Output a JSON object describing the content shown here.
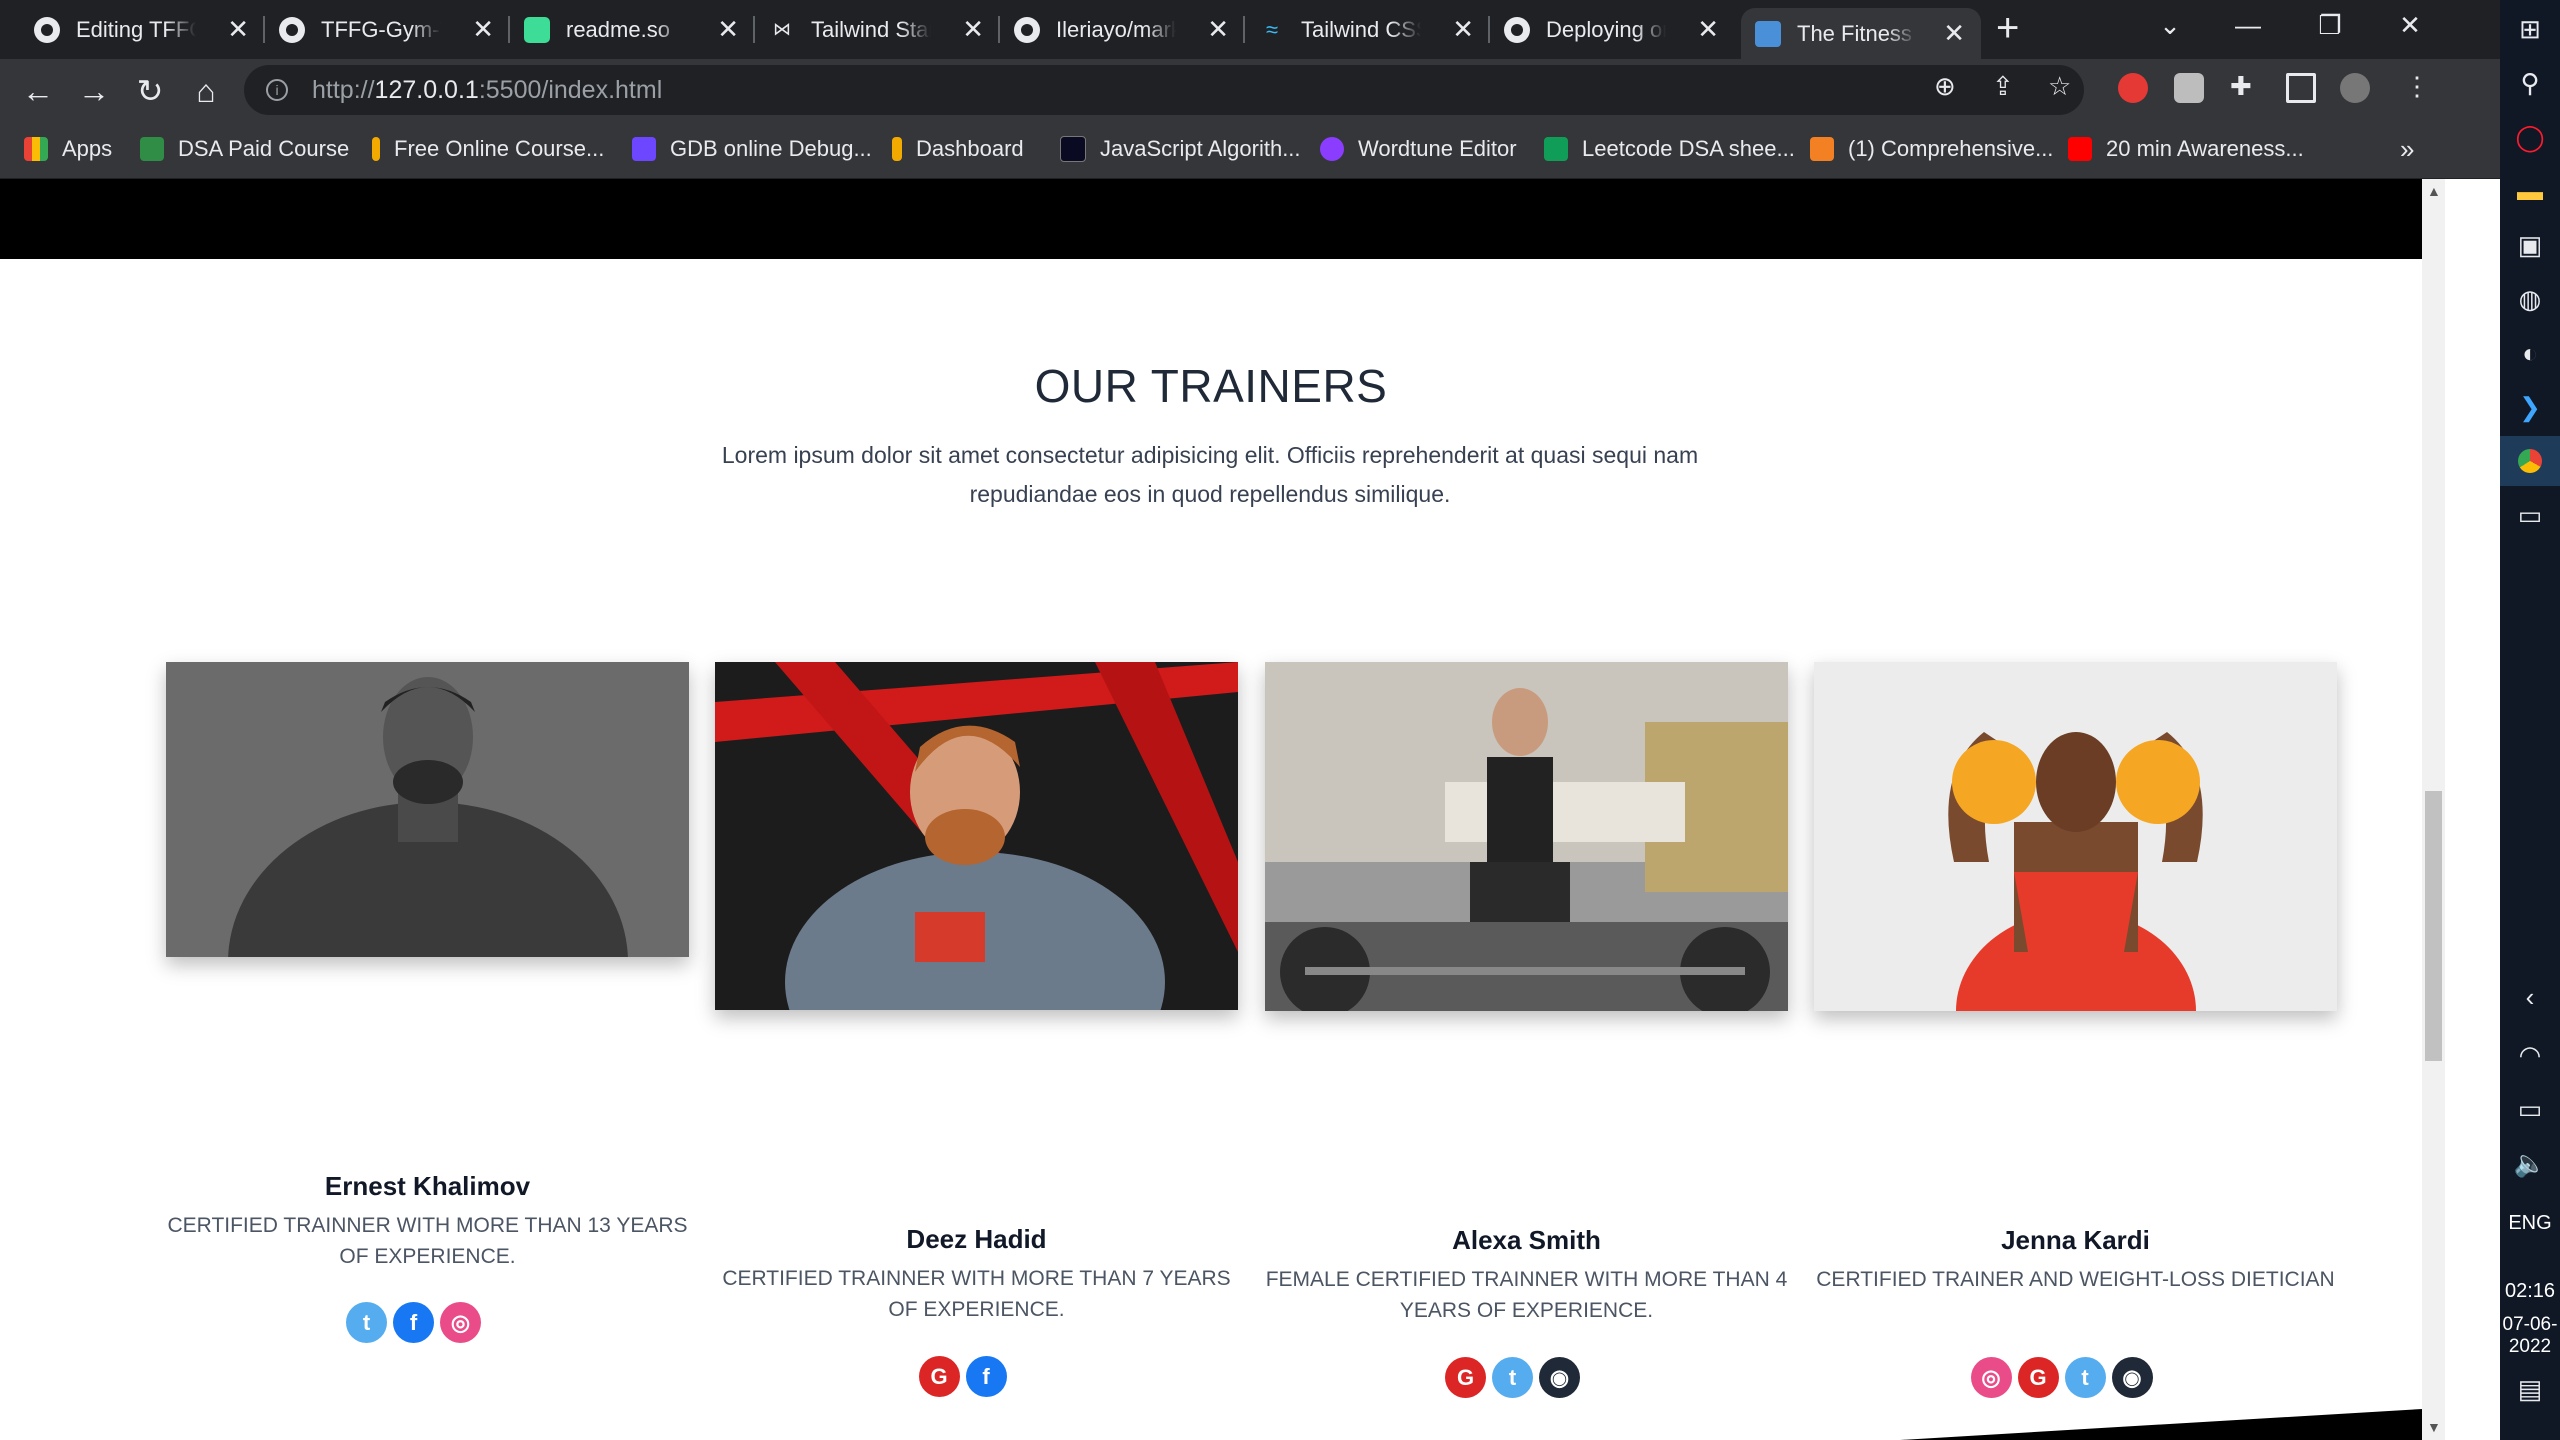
{
  "browser": {
    "tabs": [
      {
        "title": "Editing TFFG-G",
        "icon": "github-icon",
        "active": false
      },
      {
        "title": "TFFG-Gym-We",
        "icon": "github-icon",
        "active": false
      },
      {
        "title": "readme.so",
        "icon": "readme-icon",
        "active": false
      },
      {
        "title": "Tailwind Starte",
        "icon": "tailwind-starter-icon",
        "active": false
      },
      {
        "title": "Ileriayo/marko",
        "icon": "github-icon",
        "active": false
      },
      {
        "title": "Tailwind CSS -",
        "icon": "tailwind-icon",
        "active": false
      },
      {
        "title": "Deploying on",
        "icon": "github-icon",
        "active": false
      },
      {
        "title": "The Fitness Fre",
        "icon": "gym-icon",
        "active": true
      }
    ],
    "new_tab": "+",
    "url_prefix": "http://",
    "url_host": "127.0.0.1",
    "url_rest": ":5500/index.html",
    "bookmarks": [
      {
        "label": "Apps",
        "color": "#ea4335"
      },
      {
        "label": "DSA Paid Course",
        "color": "#2f8d46"
      },
      {
        "label": "Free Online Course...",
        "color": "#f2a900"
      },
      {
        "label": "GDB online Debug...",
        "color": "#6c47ff"
      },
      {
        "label": "Dashboard",
        "color": "#f2a900"
      },
      {
        "label": "JavaScript Algorith...",
        "color": "#0a0a23"
      },
      {
        "label": "Wordtune Editor",
        "color": "#8b3dff"
      },
      {
        "label": "Leetcode DSA shee...",
        "color": "#0f9d58"
      },
      {
        "label": "(1) Comprehensive...",
        "color": "#f48024"
      },
      {
        "label": "20 min Awareness...",
        "color": "#ff0000"
      }
    ],
    "more_bookmarks": "»"
  },
  "page": {
    "title": "OUR TRAINERS",
    "description": "Lorem ipsum dolor sit amet consectetur adipisicing elit. Officiis reprehenderit at quasi sequi nam repudiandae eos in quod repellendus similique.",
    "trainers": [
      {
        "name": "Ernest Khalimov",
        "role": "Certified trainner with more than 13 years of experience.",
        "socials": [
          "twitter",
          "facebook",
          "dribbble"
        ]
      },
      {
        "name": "Deez Hadid",
        "role": "Certified trainner with more than 7 years of experience.",
        "socials": [
          "google",
          "facebook"
        ]
      },
      {
        "name": "Alexa Smith",
        "role": "Female certified trainner with more than 4 years of experience.",
        "socials": [
          "google",
          "twitter",
          "instagram"
        ]
      },
      {
        "name": "Jenna Kardi",
        "role": "Certified trainer and weight-loss dietician",
        "socials": [
          "dribbble",
          "google",
          "twitter",
          "instagram"
        ]
      }
    ]
  },
  "taskbar": {
    "language": "ENG",
    "time": "02:16",
    "date": "07-06-2022"
  },
  "colors": {
    "twitter": "#55acee",
    "facebook": "#1877f2",
    "dribbble": "#ea4c89",
    "google": "#dc2626",
    "instagram": "#1f2937"
  }
}
